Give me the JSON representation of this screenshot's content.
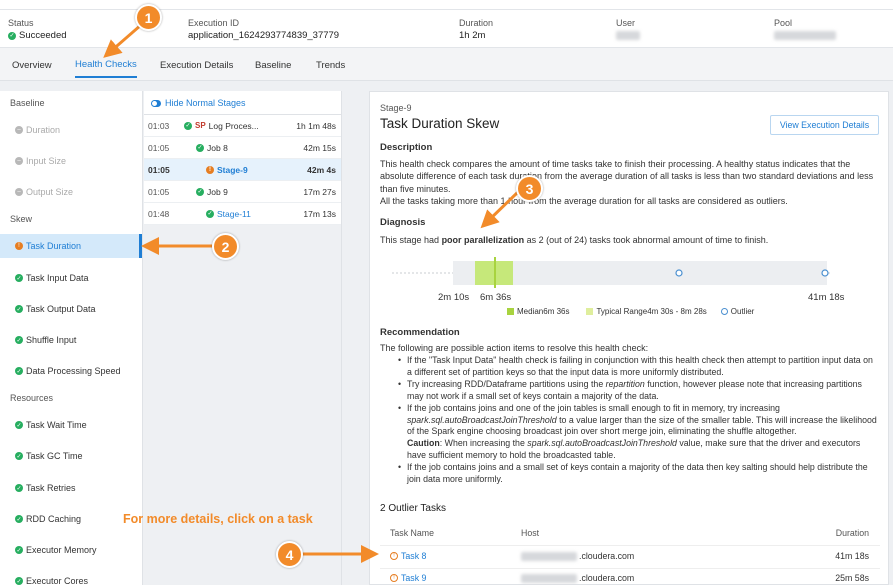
{
  "summary": {
    "status_label": "Status",
    "status_value": "Succeeded",
    "execution_id_label": "Execution ID",
    "execution_id_value": "application_1624293774839_37779",
    "duration_label": "Duration",
    "duration_value": "1h 2m",
    "user_label": "User",
    "pool_label": "Pool"
  },
  "tabs": [
    {
      "label": "Overview"
    },
    {
      "label": "Health Checks"
    },
    {
      "label": "Execution Details"
    },
    {
      "label": "Baseline"
    },
    {
      "label": "Trends"
    }
  ],
  "sidebar": {
    "sections": [
      {
        "heading": "Baseline",
        "items": [
          "Duration",
          "Input Size",
          "Output Size"
        ]
      },
      {
        "heading": "Skew",
        "items": [
          "Task Duration",
          "Task Input Data",
          "Task Output Data",
          "Shuffle Input",
          "Data Processing Speed"
        ]
      },
      {
        "heading": "Resources",
        "items": [
          "Task Wait Time",
          "Task GC Time",
          "Task Retries",
          "RDD Caching",
          "Executor Memory",
          "Executor Cores"
        ]
      }
    ]
  },
  "stages": {
    "toggle_label": "Hide Normal Stages",
    "rows": [
      {
        "time": "01:03",
        "badge": "SP",
        "name": "Log Proces...",
        "duration": "1h 1m 48s"
      },
      {
        "time": "01:05",
        "name": "Job 8",
        "duration": "42m 15s"
      },
      {
        "time": "01:05",
        "name": "Stage-9",
        "duration": "42m 4s"
      },
      {
        "time": "01:05",
        "name": "Job 9",
        "duration": "17m 27s"
      },
      {
        "time": "01:48",
        "name": "Stage-11",
        "duration": "17m 13s"
      }
    ]
  },
  "detail": {
    "stage": "Stage-9",
    "title": "Task Duration Skew",
    "view_button": "View Execution Details",
    "description_heading": "Description",
    "description_p1": "This health check compares the amount of time tasks take to finish their processing. A healthy status indicates that the absolute difference of each task duration from the average duration of all tasks is less than two standard deviations and less than five minutes.",
    "description_p2": "All the tasks taking more than 1 hour from the average duration for all tasks are considered as outliers.",
    "diagnosis_heading": "Diagnosis",
    "diagnosis_pre": "This stage had",
    "diagnosis_bold": "poor parallelization",
    "diagnosis_post": "as 2 (out of 24) tasks took abnormal amount of time to finish.",
    "axis_labels": [
      "2m 10s",
      "6m 36s",
      "41m 18s"
    ],
    "legend": {
      "median_label": "Median",
      "median_value": "6m 36s",
      "range_label": "Typical Range",
      "range_value": "4m 30s - 8m 28s",
      "outlier_label": "Outlier"
    },
    "recommendation_heading": "Recommendation",
    "recommendation_intro": "The following are possible action items to resolve this health check:",
    "rec1": "If the \"Task Input Data\" health check is failing in conjunction with this health check then attempt to partition input data on a different set of partition keys so that the input data is more uniformly distributed.",
    "rec2_a": "Try increasing RDD/Dataframe partitions using the",
    "rec2_em": "repartition",
    "rec2_b": "function, however please note that increasing partitions may not work if a small set of keys contain a majority of the data.",
    "rec3_a": "If the job contains joins and one of the join tables is small enough to fit in memory, try increasing",
    "rec3_em": "spark.sql.autoBroadcastJoinThreshold",
    "rec3_b": "to a value larger than the size of the smaller table. This will increase the likelihood of the Spark engine choosing broadcast join over short merge join, eliminating the shuffle altogether.",
    "rec3_caution": "Caution",
    "rec3_c": ": When increasing the",
    "rec3_em2": "spark.sql.autoBroadcastJoinThreshold",
    "rec3_d": "value, make sure that the driver and executors have sufficient memory to hold the broadcasted table.",
    "rec4": "If the job contains joins and a small set of keys contain a majority of the data then key salting should help distribute the join data more uniformly.",
    "outlier_heading": "2 Outlier Tasks",
    "outlier_cols": [
      "Task Name",
      "Host",
      "Duration"
    ],
    "outlier_rows": [
      {
        "name": "Task 8",
        "host_suffix": ".cloudera.com",
        "duration": "41m 18s"
      },
      {
        "name": "Task 9",
        "host_suffix": ".cloudera.com",
        "duration": "25m 58s"
      }
    ]
  },
  "annotations": {
    "callout_1": "1",
    "callout_2": "2",
    "callout_3": "3",
    "callout_4": "4",
    "hint": "For more details, click on a task"
  },
  "colors": {
    "accent": "#1f7ed4",
    "success": "#27ae60",
    "warning": "#e67e22",
    "annotation": "#f28b2a",
    "median": "#c6e87a"
  }
}
